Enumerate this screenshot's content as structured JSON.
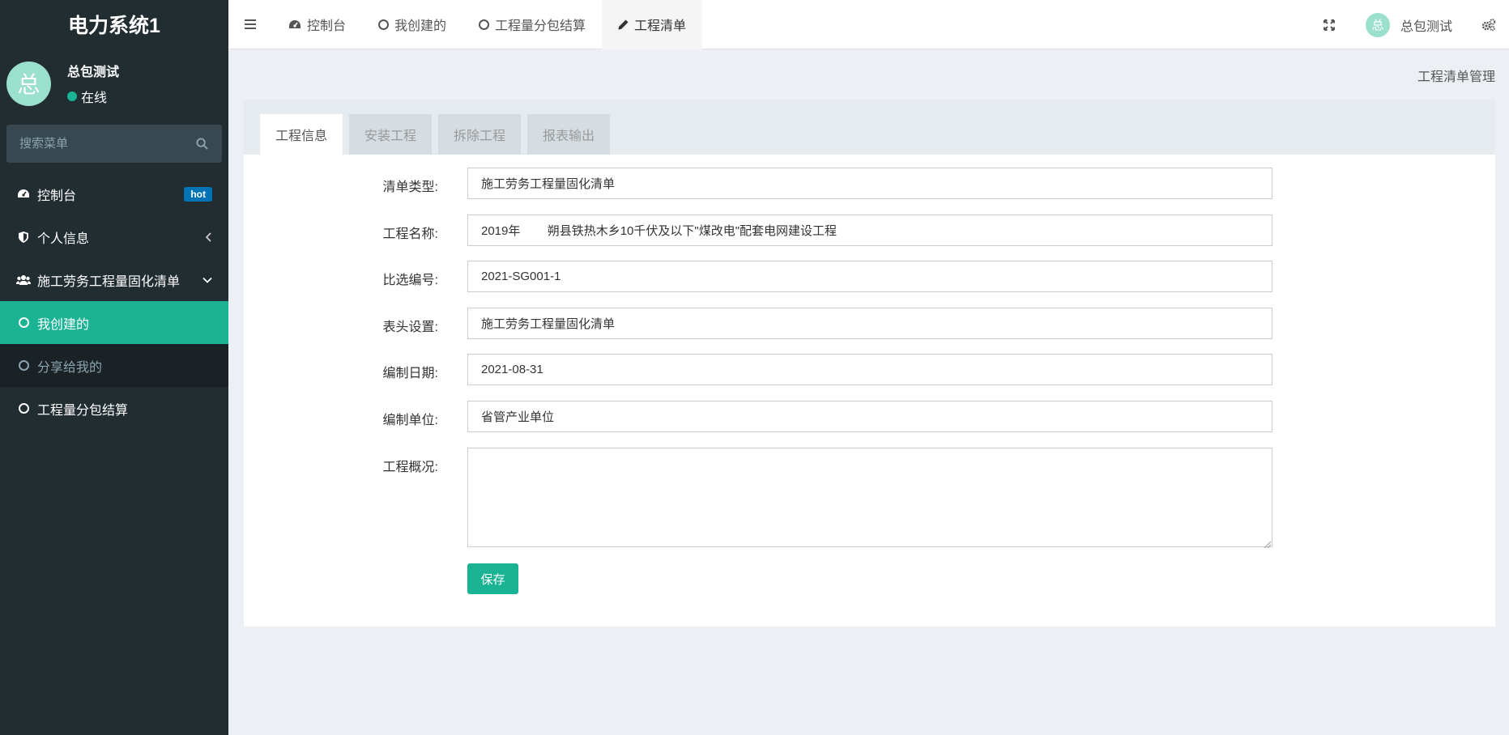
{
  "sidebar": {
    "logo": "电力系统1",
    "avatar_char": "总",
    "user_name": "总包测试",
    "user_status": "在线",
    "search_placeholder": "搜索菜单",
    "items": [
      {
        "label": "控制台",
        "badge": "hot",
        "icon": "dashboard-icon"
      },
      {
        "label": "个人信息",
        "icon": "shield-icon"
      },
      {
        "label": "施工劳务工程量固化清单",
        "icon": "users-icon"
      },
      {
        "label": "我创建的",
        "icon": "circle-icon"
      },
      {
        "label": "分享给我的",
        "icon": "circle-icon"
      },
      {
        "label": "工程量分包结算",
        "icon": "circle-icon"
      }
    ]
  },
  "topbar": {
    "tabs": [
      {
        "label": "控制台",
        "icon": "dashboard-icon"
      },
      {
        "label": "我创建的",
        "icon": "circle-icon"
      },
      {
        "label": "工程量分包结算",
        "icon": "circle-icon"
      },
      {
        "label": "工程清单",
        "icon": "pencil-icon"
      }
    ],
    "avatar_char": "总",
    "user_name": "总包测试"
  },
  "breadcrumb": "工程清单管理",
  "content_tabs": [
    "工程信息",
    "安装工程",
    "拆除工程",
    "报表输出"
  ],
  "form": {
    "fields": [
      {
        "label": "清单类型:",
        "value": "施工劳务工程量固化清单"
      },
      {
        "label": "工程名称:",
        "value": "2019年        朔县铁热木乡10千伏及以下\"煤改电\"配套电网建设工程"
      },
      {
        "label": "比选编号:",
        "value": "2021-SG001-1"
      },
      {
        "label": "表头设置:",
        "value": "施工劳务工程量固化清单"
      },
      {
        "label": "编制日期:",
        "value": "2021-08-31"
      },
      {
        "label": "编制单位:",
        "value": "省管产业单位"
      }
    ],
    "overview_label": "工程概况:",
    "overview_value": "",
    "save_label": "保存"
  },
  "colors": {
    "accent": "#1ab394",
    "sidebar_bg": "#222d32",
    "badge": "#0073b7"
  }
}
